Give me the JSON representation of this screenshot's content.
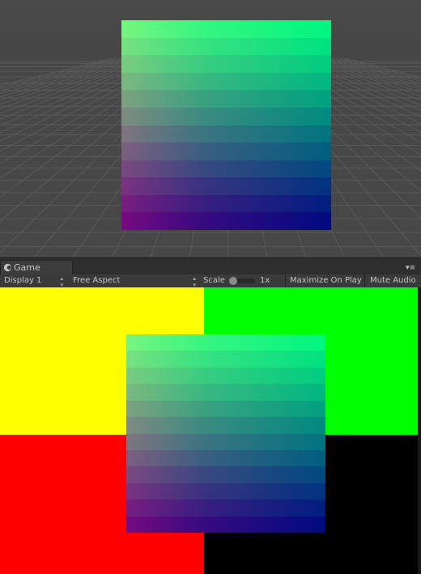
{
  "game_tab": {
    "label": "Game",
    "icon": "game-controller-icon",
    "menu_icon": "tab-menu-icon"
  },
  "toolbar": {
    "display": "Display 1",
    "aspect": "Free Aspect",
    "scale_label": "Scale",
    "scale_value": "1x",
    "scale_level": 0,
    "maximize_on_play": "Maximize On Play",
    "mute_audio": "Mute Audio"
  },
  "game_view": {
    "quadrant_colors": {
      "top_left": "#ffff00",
      "top_right": "#00ff00",
      "bottom_left": "#ff0000",
      "bottom_right": "#000000"
    }
  },
  "quad_gradient_colors": {
    "top_left": "#80ff80",
    "top_right": "#00ff80",
    "bottom_left": "#800080",
    "bottom_right": "#000080"
  },
  "colors": {
    "scene_background": "#474747",
    "grid_line": "#5a5a5a",
    "toolbar_background": "#3a3a3a",
    "toolbar_text": "#c4c4c4"
  }
}
